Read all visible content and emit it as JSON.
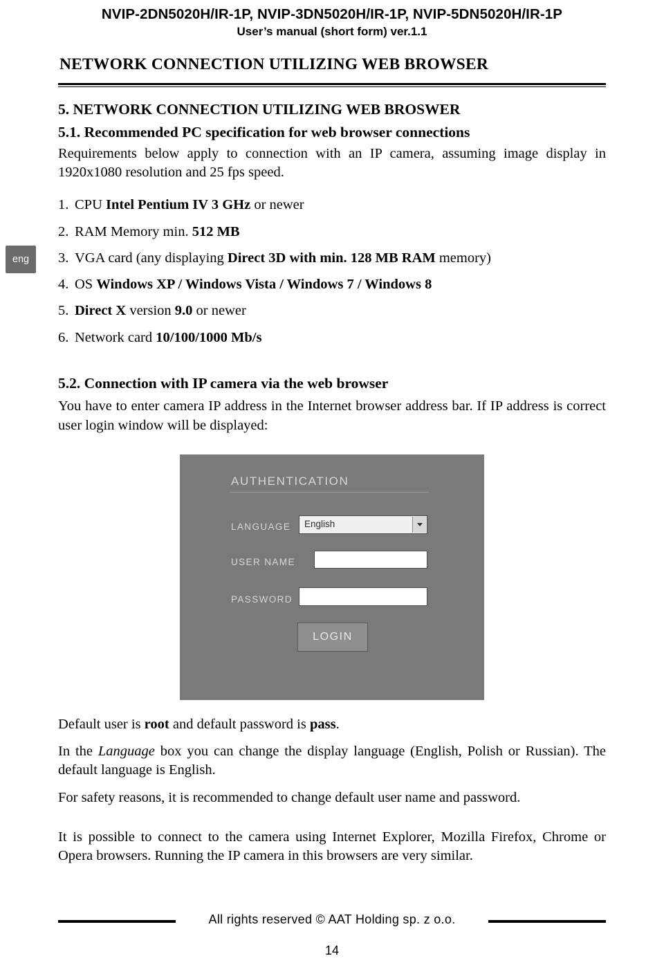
{
  "header": {
    "model_line": "NVIP-2DN5020H/IR-1P, NVIP-3DN5020H/IR-1P, NVIP-5DN5020H/IR-1P",
    "manual_line": "User’s manual (short form) ver.1.1"
  },
  "section_title": "NETWORK CONNECTION UTILIZING WEB BROWSER",
  "side_tab": {
    "label": "eng"
  },
  "chapter": {
    "heading": "5. NETWORK CONNECTION UTILIZING WEB BROSWER",
    "sub_51_number": "5.1.",
    "sub_51_title": "Recommended PC specification for web browser connections",
    "sub_51_text": "Requirements below apply to connection with an IP camera, assuming image display in 1920x1080 resolution and 25 fps speed.",
    "requirements": [
      {
        "num": "1.",
        "pre": "CPU ",
        "bold": "Intel Pentium IV 3 GHz",
        "post": " or newer"
      },
      {
        "num": "2.",
        "pre": "RAM Memory min. ",
        "bold": "512 MB",
        "post": ""
      },
      {
        "num": "3.",
        "pre": "VGA card (any displaying ",
        "bold": "Direct 3D with min. 128 MB RAM",
        "post": " memory)"
      },
      {
        "num": "4.",
        "pre": "OS ",
        "bold": "Windows XP / Windows Vista / Windows 7 / Windows 8",
        "post": ""
      },
      {
        "num": "5.",
        "pre": "",
        "bold": "Direct X",
        "post": " version ",
        "bold2": "9.0",
        "post2": " or newer"
      },
      {
        "num": "6.",
        "pre": "Network card ",
        "bold": "10/100/1000 Mb/s",
        "post": ""
      }
    ],
    "sub_52_title": "5.2. Connection with IP camera via the web browser",
    "sub_52_text": "You have to enter camera IP address in the Internet browser address bar. If IP address is correct user login window will be displayed:"
  },
  "auth_dialog": {
    "title": "AUTHENTICATION",
    "language_label": "LANGUAGE",
    "language_value": "English",
    "username_label": "USER NAME",
    "username_value": "",
    "password_label": "PASSWORD",
    "password_value": "",
    "login_button": "LOGIN",
    "background_color": "#7a7a7a"
  },
  "notes": {
    "default_user_pre": "Default user is ",
    "default_user_bold": "root",
    "default_user_mid": " and default password is ",
    "default_pass_bold": "pass",
    "default_user_post": ".",
    "language_note_pre": "In the ",
    "language_note_italic": "Language",
    "language_note_post": " box you can change the display language (English, Polish or Russian). The default language is English.",
    "safety_note": "For safety reasons, it is recommended to change default user name and password.",
    "browsers_note": "It is possible to connect to the camera using Internet Explorer, Mozilla Firefox, Chrome or Opera browsers. Running the IP camera in this browsers are very similar."
  },
  "footer": {
    "text": "All rights reserved © AAT Holding sp. z o.o.",
    "page_number": "14"
  }
}
